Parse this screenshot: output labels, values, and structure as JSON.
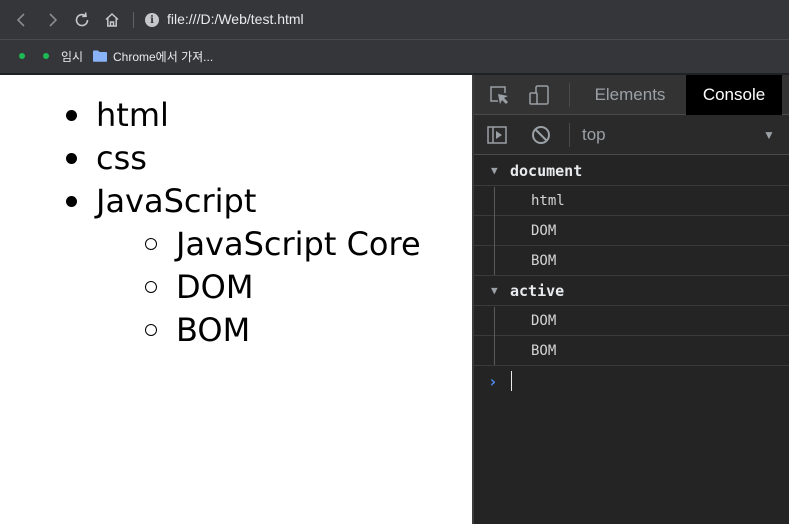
{
  "browser": {
    "url": "file:///D:/Web/test.html",
    "info_glyph": "i",
    "bookmarks": [
      {
        "label": "임시"
      },
      {
        "label": "Chrome에서 가져..."
      }
    ],
    "colors": {
      "chrome_bg": "#35363a",
      "bookmark_dot": "#1db954"
    }
  },
  "page": {
    "list": [
      "html",
      "css",
      "JavaScript"
    ],
    "sublist": [
      "JavaScript Core",
      "DOM",
      "BOM"
    ]
  },
  "devtools": {
    "tabs": [
      {
        "label": "Elements",
        "active": false
      },
      {
        "label": "Console",
        "active": true
      }
    ],
    "context": "top",
    "context_caret": "▼",
    "console": {
      "groups": [
        {
          "label": "document",
          "expanded": true,
          "items": [
            "html",
            "DOM",
            "BOM"
          ]
        },
        {
          "label": "active",
          "expanded": true,
          "items": [
            "DOM",
            "BOM"
          ]
        }
      ],
      "prompt": "›",
      "expanded_glyph": "▼"
    },
    "colors": {
      "active_tab_bg": "#000000",
      "prompt": "#4e8cf7"
    }
  }
}
